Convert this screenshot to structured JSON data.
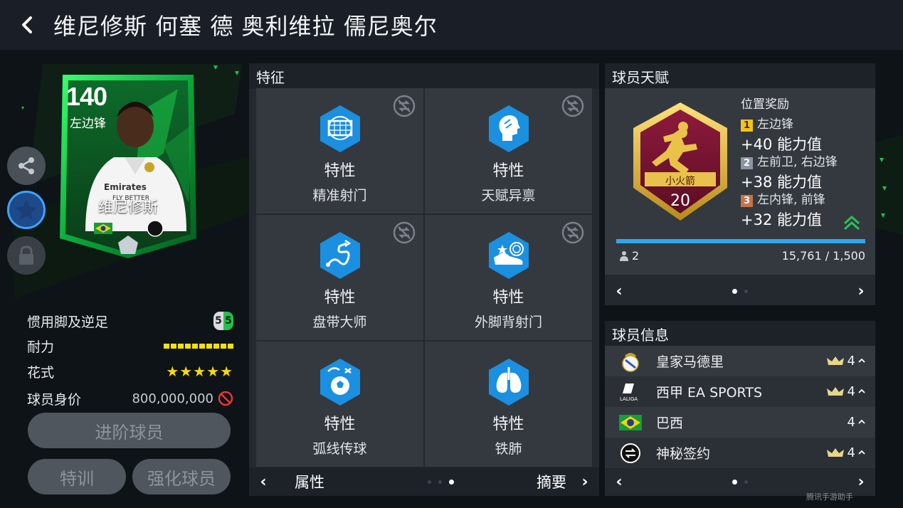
{
  "header": {
    "title": "维尼修斯 何塞 德 奥利维拉 儒尼奥尔",
    "back_icon": "chevron-left-icon"
  },
  "card": {
    "rating": "140",
    "position": "左边锋",
    "name": "维尼修斯"
  },
  "sidebar": {
    "share_icon": "share-icon",
    "favorite_icon": "star-icon",
    "lock_icon": "lock-icon"
  },
  "stats": {
    "foot_label": "惯用脚及逆足",
    "foot_primary": "5",
    "foot_weak": "5",
    "stamina_label": "耐力",
    "stamina_level": 1.0,
    "skill_label": "花式",
    "skill_stars": "★★★★★",
    "skill_value": 5,
    "price_label": "球员身价",
    "price_value": "800,000,000"
  },
  "buttons": {
    "advance": "进阶球员",
    "train": "特训",
    "enhance": "强化球员"
  },
  "features": {
    "title": "特征",
    "items": [
      {
        "type": "特性",
        "name": "精准射门",
        "icon": "goal-net-icon",
        "swappable": true
      },
      {
        "type": "特性",
        "name": "天赋异禀",
        "icon": "head-profile-icon",
        "swappable": true
      },
      {
        "type": "特性",
        "name": "盘带大师",
        "icon": "dribble-path-icon",
        "swappable": true
      },
      {
        "type": "特性",
        "name": "外脚背射门",
        "icon": "boot-icon",
        "swappable": true
      },
      {
        "type": "特性",
        "name": "弧线传球",
        "icon": "curve-ball-icon",
        "swappable": false
      },
      {
        "type": "特性",
        "name": "铁肺",
        "icon": "lungs-icon",
        "swappable": false
      }
    ],
    "footer_left": "属性",
    "footer_right": "摘要"
  },
  "talent": {
    "title": "球员天赋",
    "badge_name": "小火箭",
    "badge_level": "20",
    "reward_title": "位置奖励",
    "rewards": [
      {
        "rank": "1",
        "positions": "左边锋",
        "bonus": "+40 能力值",
        "color": "#f0c419"
      },
      {
        "rank": "2",
        "positions": "左前卫, 右边锋",
        "bonus": "+38 能力值",
        "color": "#8b95a3"
      },
      {
        "rank": "3",
        "positions": "左内锋, 前锋",
        "bonus": "+32 能力值",
        "color": "#c4744a"
      }
    ],
    "count": "2",
    "progress_text": "15,761 / 1,500",
    "progress_fraction": 1.0
  },
  "info": {
    "title": "球员信息",
    "rows": [
      {
        "label": "皇家马德里",
        "rating": "4",
        "icon": "real-madrid-crest-icon",
        "crown": true
      },
      {
        "label": "西甲 EA SPORTS",
        "rating": "4",
        "icon": "laliga-logo-icon",
        "crown": true
      },
      {
        "label": "巴西",
        "rating": "4",
        "icon": "brazil-flag-icon",
        "crown": false
      },
      {
        "label": "神秘签约",
        "rating": "4",
        "icon": "mystery-sign-icon",
        "crown": true
      }
    ]
  },
  "watermark": "腾讯手游助手",
  "colors": {
    "accent_green": "#24e05a",
    "accent_blue": "#2ea8ef",
    "panel": "#34393f",
    "gold": "#f5d90a"
  }
}
